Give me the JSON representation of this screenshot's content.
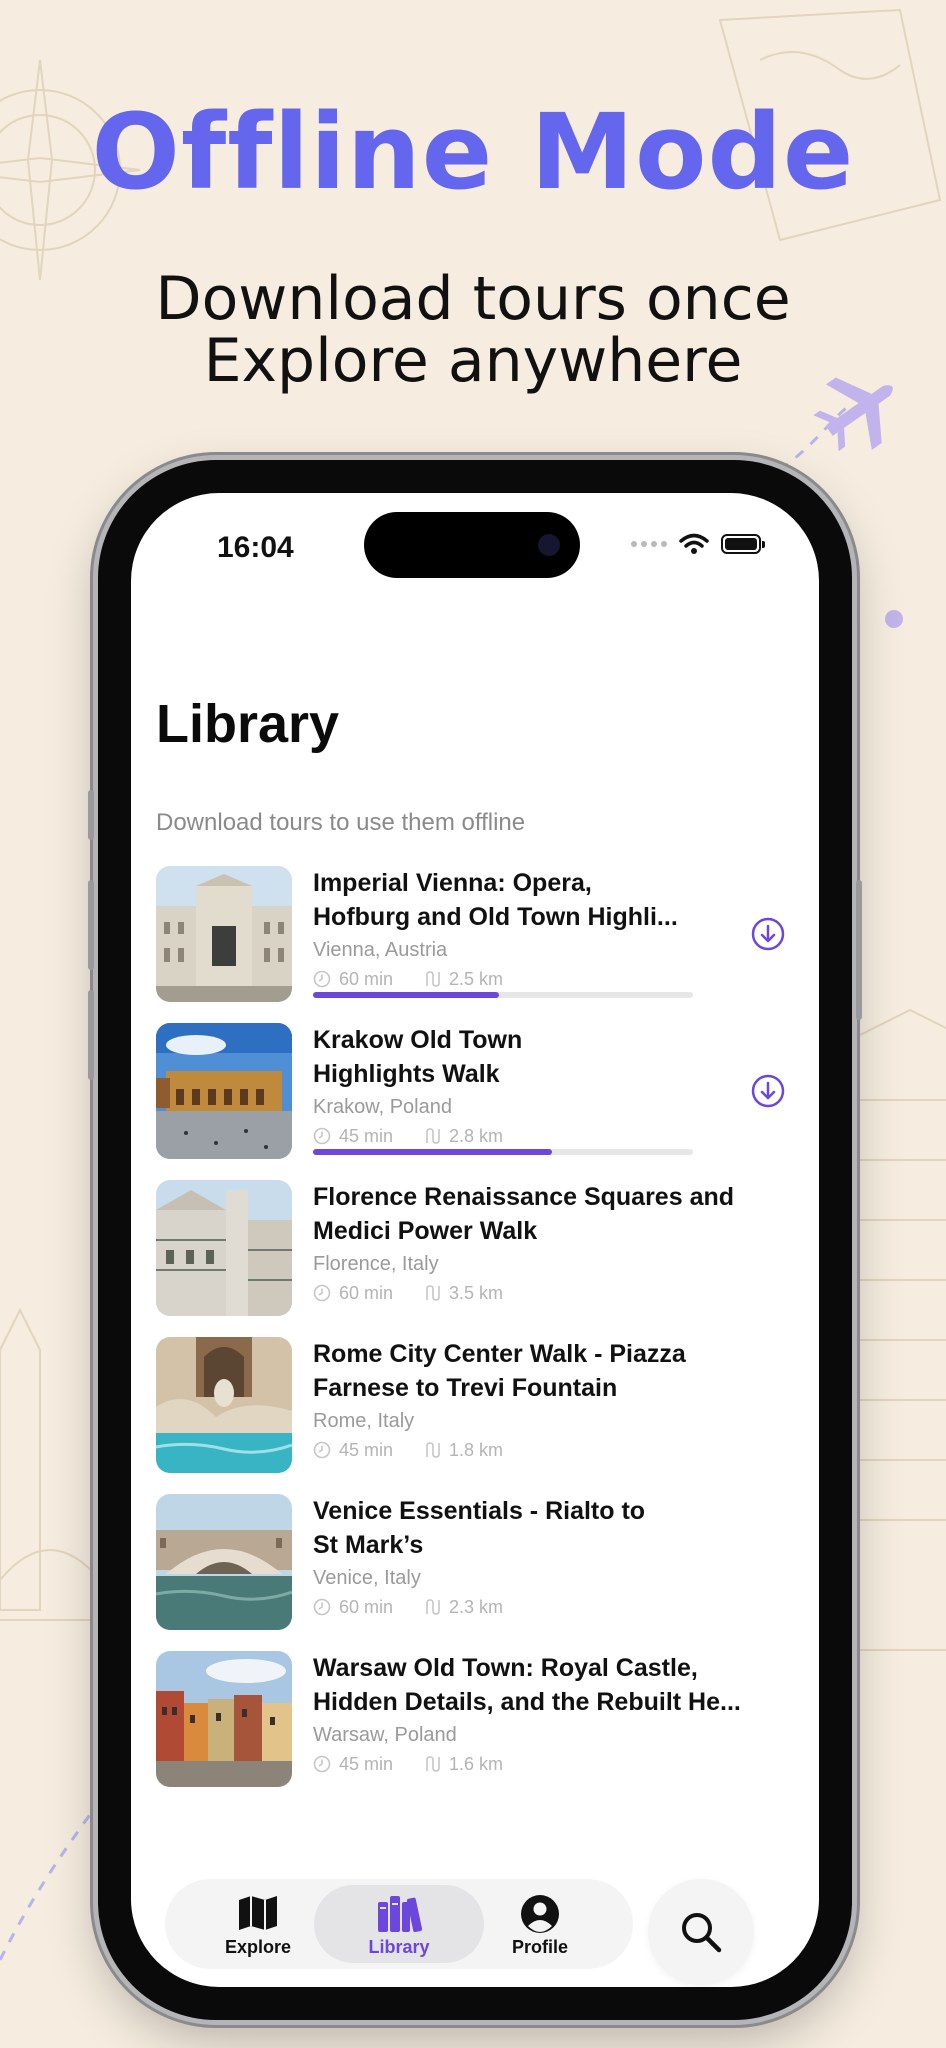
{
  "promo": {
    "headline": "Offline Mode",
    "subline_1": "Download tours once",
    "subline_2": "Explore anywhere"
  },
  "status_bar": {
    "time": "16:04"
  },
  "library": {
    "title": "Library",
    "subtitle": "Download tours to use them offline",
    "tours": [
      {
        "name_1": "Imperial Vienna: Opera,",
        "name_2": "Hofburg and Old Town Highli...",
        "location": "Vienna, Austria",
        "duration": "60 min",
        "distance": "2.5 km",
        "download_progress": 0.49,
        "downloading": true
      },
      {
        "name_1": "Krakow Old Town",
        "name_2": "Highlights Walk",
        "location": "Krakow, Poland",
        "duration": "45 min",
        "distance": "2.8 km",
        "download_progress": 0.63,
        "downloading": true
      },
      {
        "name_1": "Florence Renaissance Squares and",
        "name_2": "Medici Power Walk",
        "location": "Florence, Italy",
        "duration": "60 min",
        "distance": "3.5 km",
        "downloading": false
      },
      {
        "name_1": "Rome City Center Walk - Piazza",
        "name_2": "Farnese to Trevi Fountain",
        "location": "Rome, Italy",
        "duration": "45 min",
        "distance": "1.8 km",
        "downloading": false
      },
      {
        "name_1": "Venice Essentials - Rialto to",
        "name_2": "St Mark’s",
        "location": "Venice, Italy",
        "duration": "60 min",
        "distance": "2.3 km",
        "downloading": false
      },
      {
        "name_1": "Warsaw Old Town: Royal Castle,",
        "name_2": "Hidden Details, and the Rebuilt He...",
        "location": "Warsaw, Poland",
        "duration": "45 min",
        "distance": "1.6 km",
        "downloading": false
      }
    ]
  },
  "tabbar": {
    "explore": "Explore",
    "library": "Library",
    "profile": "Profile",
    "active": "library"
  },
  "colors": {
    "accent": "#6b47dc",
    "headline": "#6566ee",
    "background": "#f6ede0"
  },
  "icons": {
    "duration": "clock-icon",
    "distance": "route-icon",
    "download": "download-icon",
    "explore": "map-icon",
    "library": "books-icon",
    "profile": "person-circle-icon",
    "search": "search-icon"
  }
}
